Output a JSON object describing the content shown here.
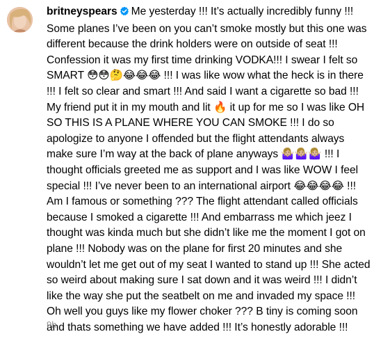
{
  "comment": {
    "username": "britneyspears",
    "caption_parts": [
      "Me yesterday !!! It’s actually incredibly funny !!! Some planes I’ve been on you can’t smoke mostly but this one was different because the drink holders were on outside of seat !!! Confession it was my first time drinking VODKA!!! I swear I felt so SMART ",
      " !!! I was like wow what the heck is in there !!! I felt so clear and smart !!! And said I want a cigarette so bad !!! My friend put it in my mouth and lit ",
      " it up for me so I was like OH SO THIS IS A PLANE WHERE YOU CAN SMOKE !!! I do so apologize to anyone I offended but the flight attendants always make sure I’m way at the back of plane anyways ",
      " !!! I thought officials greeted me as support and I was like WOW I feel special !!! I’ve never been to an international airport ",
      " !!! Am I famous or something ??? The flight attendant called officials because I smoked a cigarette !!! And embarrass me which jeez I thought was kinda much but she didn’t like me the moment I got on plane !!! Nobody was on the plane for first 20 minutes and she wouldn’t let me get out of my seat I wanted to stand up !!! She acted so weird about making sure I sat down and it was weird !!! I didn’t like the way she put the seatbelt on me and invaded my space !!! Oh well you guys like my flower choker ??? B tiny is coming soon and thats something we have added !!! It’s honestly adorable !!!"
    ],
    "emojis": {
      "smart": "😳😳🤔😂😂😂",
      "fire": "🔥",
      "dancers": "🤷🏼‍♀️🤷🏼‍♀️🤷🏼‍♀️",
      "laughing": "😂😂😂😂"
    },
    "time_ago": "9h"
  },
  "icons": {
    "avatar": "profile-avatar",
    "verified": "verified-badge-icon"
  },
  "colors": {
    "verified_blue": "#0095f6",
    "meta_gray": "#8e8e8e"
  }
}
